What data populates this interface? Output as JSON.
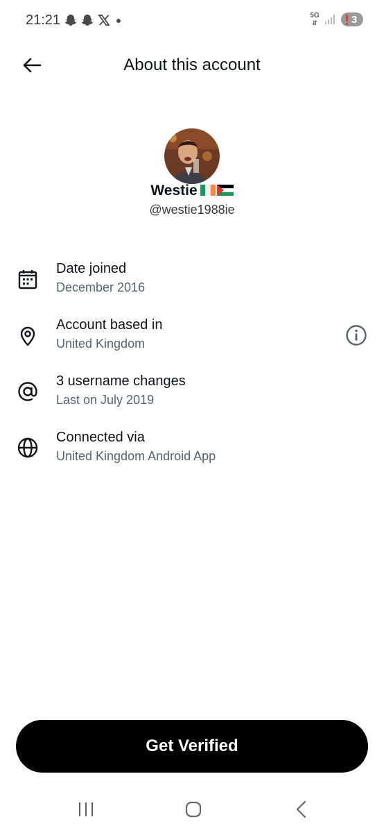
{
  "status_bar": {
    "time": "21:21",
    "network": "5G",
    "battery_count": "3",
    "icons_left": [
      "snapchat-icon",
      "snapchat-icon",
      "x-logo-icon",
      "dot-icon"
    ],
    "icons_right": [
      "5g-data-icon",
      "signal-icon",
      "battery-icon"
    ]
  },
  "header": {
    "back_icon": "arrow-left-icon",
    "title": "About this account"
  },
  "profile": {
    "name": "Westie",
    "flags": [
      "ireland-flag",
      "palestine-flag"
    ],
    "handle": "@westie1988ie"
  },
  "rows": [
    {
      "icon": "calendar-icon",
      "title": "Date joined",
      "subtitle": "December 2016"
    },
    {
      "icon": "location-pin-icon",
      "title": "Account based in",
      "subtitle": "United Kingdom",
      "action_icon": "info-icon"
    },
    {
      "icon": "at-sign-icon",
      "title": "3 username changes",
      "subtitle": "Last on July 2019"
    },
    {
      "icon": "globe-icon",
      "title": "Connected via",
      "subtitle": "United Kingdom Android App"
    }
  ],
  "verify_button": {
    "label": "Get Verified"
  },
  "nav_bar": {
    "items": [
      "recent-apps-icon",
      "home-icon",
      "back-icon"
    ]
  },
  "colors": {
    "text_primary": "#0f1419",
    "text_secondary": "#536471",
    "button_bg": "#000000",
    "background": "#ffffff"
  }
}
